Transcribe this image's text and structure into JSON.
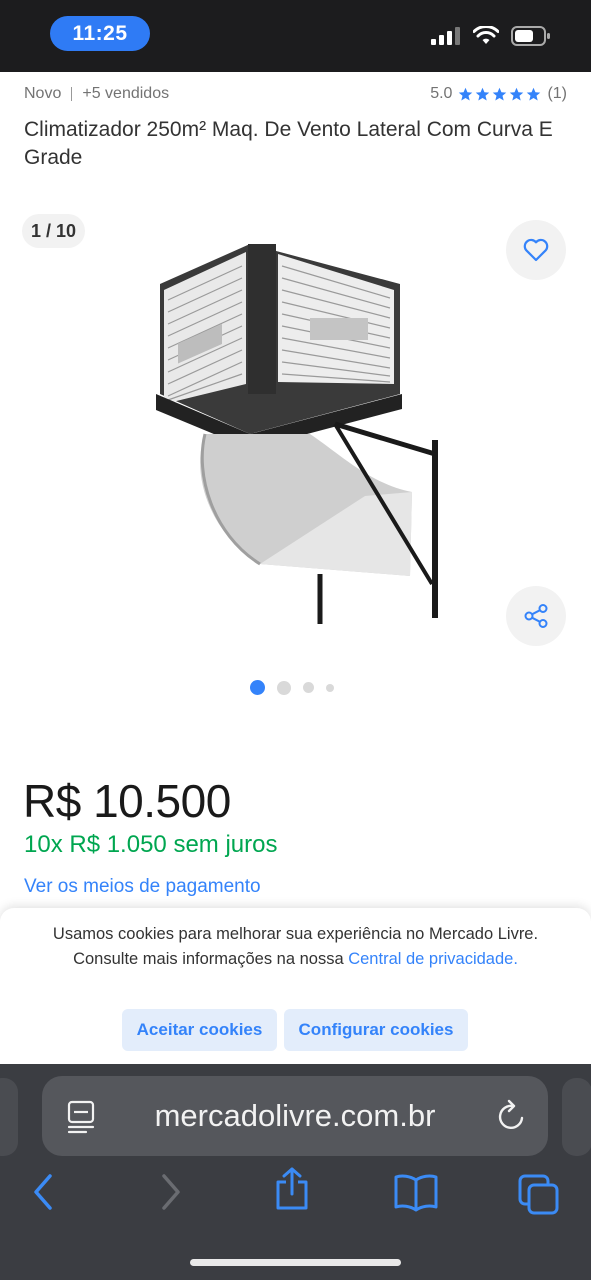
{
  "status_bar": {
    "time": "11:25"
  },
  "product": {
    "condition": "Novo",
    "sold": "+5 vendidos",
    "rating": "5.0",
    "rating_count": "(1)",
    "stars": 5,
    "title": "Climatizador 250m² Maq. De Vento Lateral Com Curva E Grade",
    "gallery_counter": "1 / 10",
    "gallery_active_index": 1,
    "price": "R$ 10.500",
    "installments": "10x R$ 1.050 sem juros",
    "payment_link": "Ver os meios de pagamento"
  },
  "cookie_banner": {
    "text": "Usamos cookies para melhorar sua experiência no Mercado Livre. Consulte mais informações na nossa ",
    "link": "Central de privacidade.",
    "accept_label": "Aceitar cookies",
    "config_label": "Configurar cookies"
  },
  "browser": {
    "url": "mercadolivre.com.br"
  },
  "colors": {
    "accent": "#3483fa",
    "green": "#00a650",
    "time_pill": "#2f7bf5"
  },
  "icons": [
    "signal-icon",
    "wifi-icon",
    "battery-icon",
    "star-icon",
    "heart-icon",
    "share-icon",
    "reader-icon",
    "reload-icon",
    "back-icon",
    "forward-icon",
    "share-sheet-icon",
    "bookmarks-icon",
    "tabs-icon"
  ]
}
